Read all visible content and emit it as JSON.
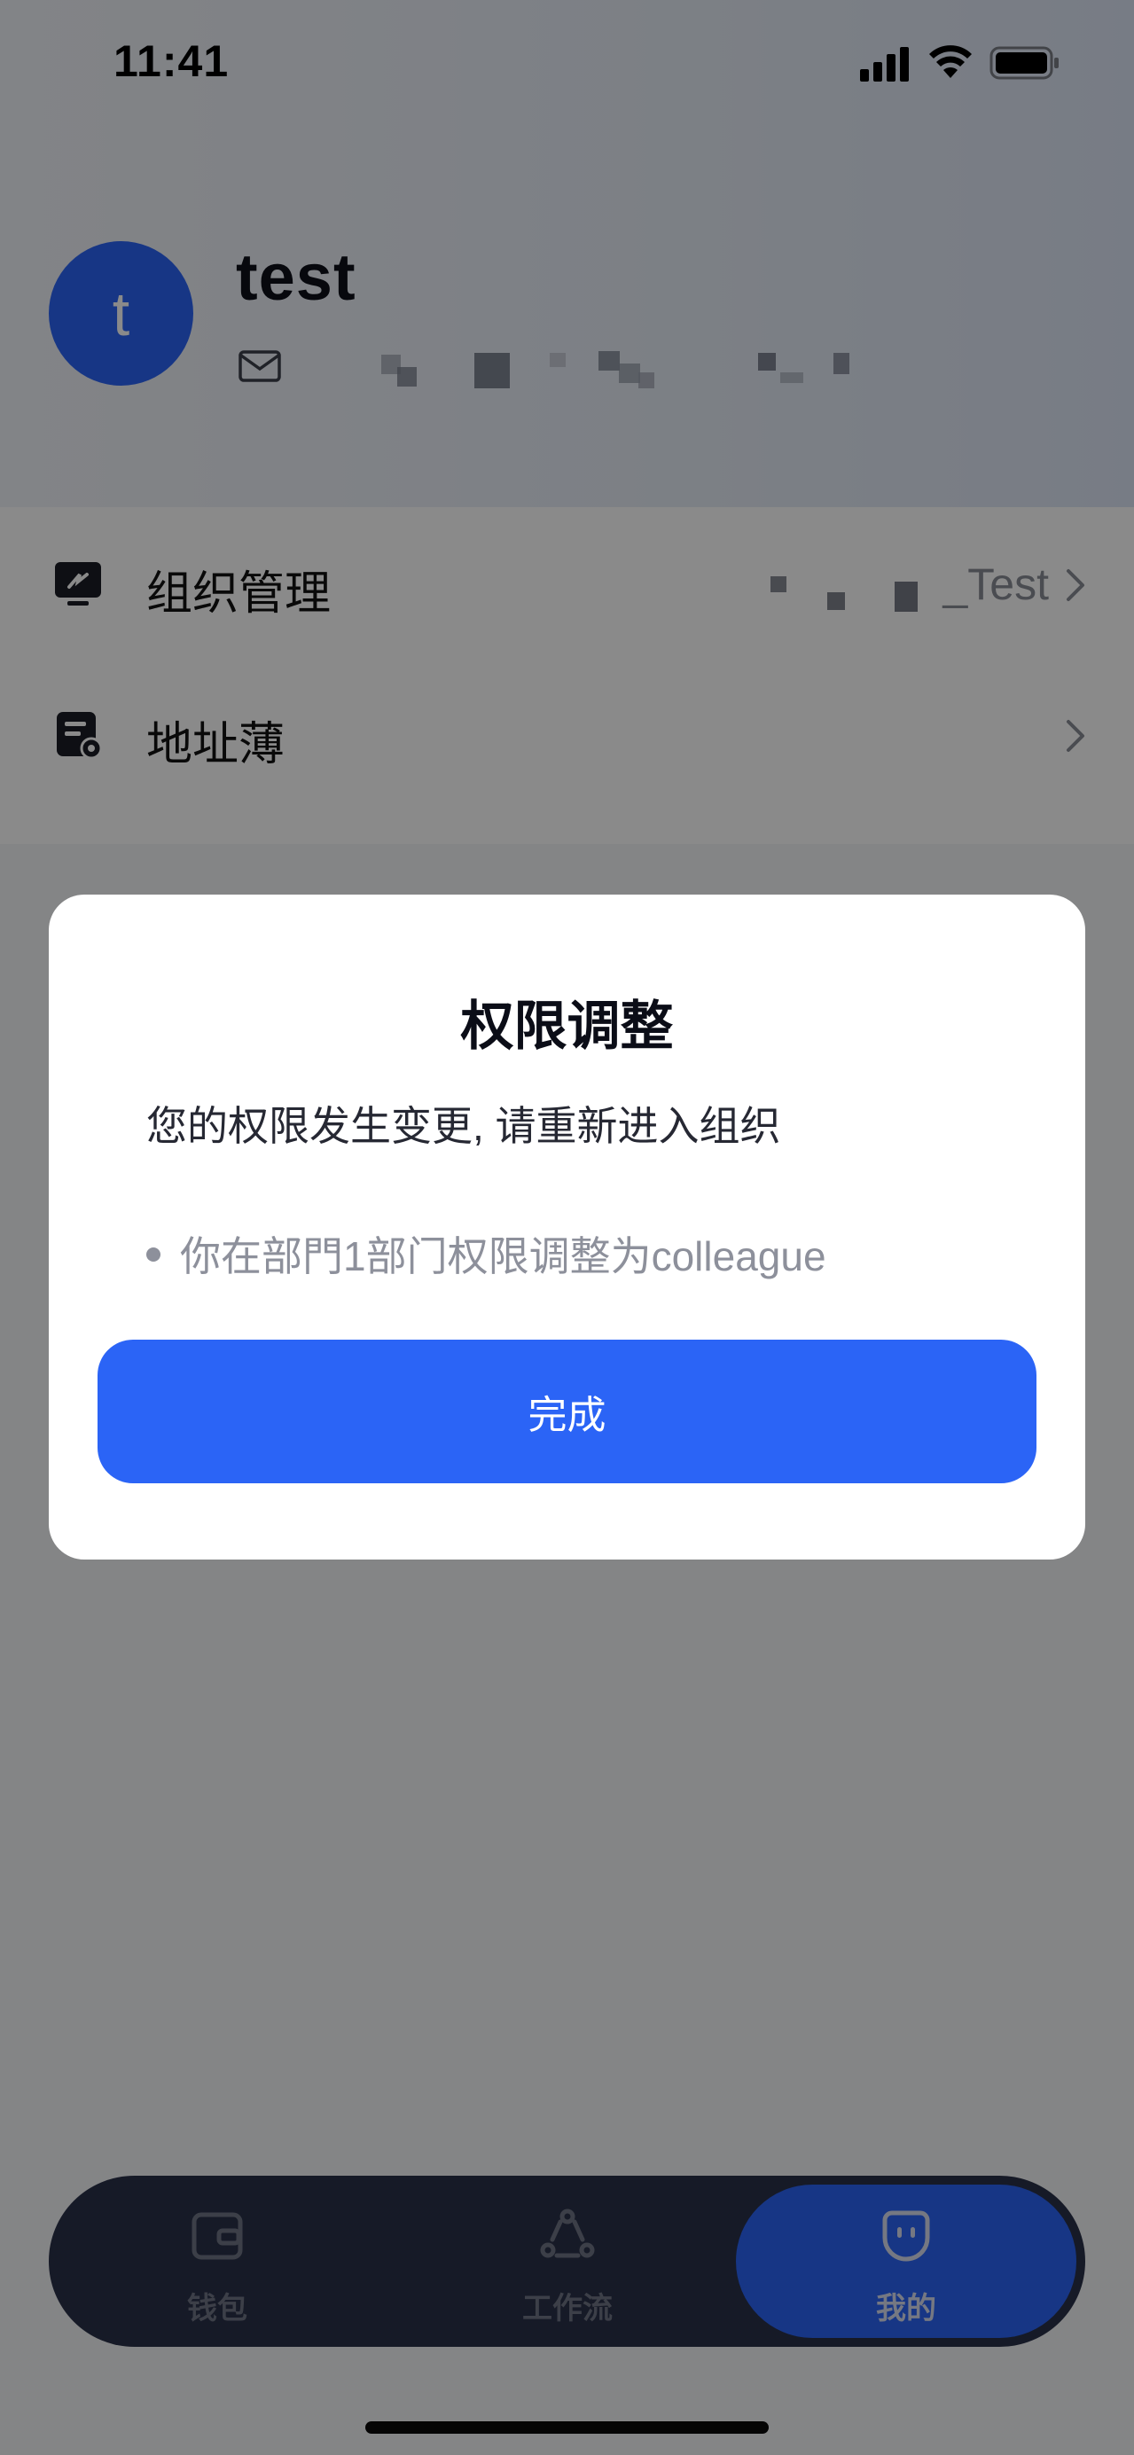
{
  "status_bar": {
    "time": "11:41"
  },
  "profile": {
    "avatar_letter": "t",
    "username": "test"
  },
  "menu": {
    "items": [
      {
        "label": "组织管理",
        "value": "_Test"
      },
      {
        "label": "地址薄",
        "value": ""
      }
    ]
  },
  "dialog": {
    "title": "权限调整",
    "message": "您的权限发生变更, 请重新进入组织",
    "bullet": "你在部門1部门权限调整为colleague",
    "button_label": "完成"
  },
  "tabbar": {
    "tabs": [
      {
        "label": "钱包",
        "icon": "wallet-icon"
      },
      {
        "label": "工作流",
        "icon": "workflow-icon"
      },
      {
        "label": "我的",
        "icon": "profile-face-icon"
      }
    ],
    "active_index": 2
  },
  "colors": {
    "primary": "#2b64f6",
    "tabbar": "#2a3148"
  }
}
